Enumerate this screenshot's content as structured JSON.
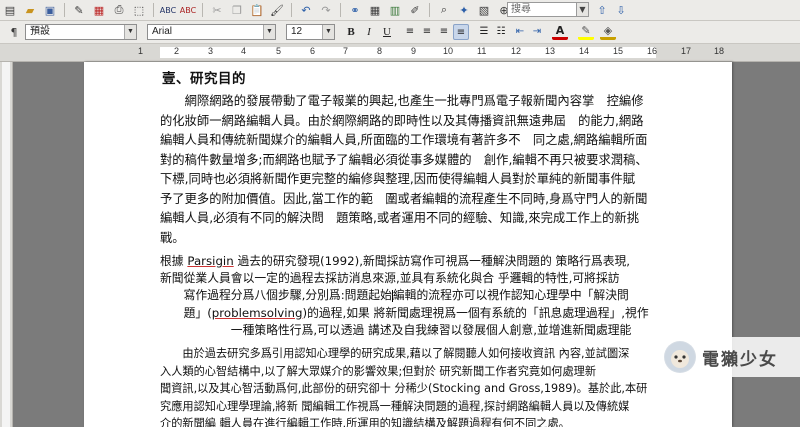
{
  "toolbar": {
    "search_value": "搜尋",
    "icons": [
      "new-icon",
      "open-icon",
      "save-icon",
      "edit-icon",
      "pdf-icon",
      "print-icon",
      "preview-icon",
      "spellcheck-icon",
      "autospell-icon",
      "cut-icon",
      "copy-icon",
      "paste-icon",
      "format-paint-icon",
      "undo-icon",
      "redo-icon",
      "hyperlink-icon",
      "table-icon",
      "chart-icon",
      "draw-icon",
      "find-icon",
      "navigator-icon",
      "gallery-icon",
      "zoom-icon",
      "help-icon"
    ]
  },
  "format": {
    "style": "預設",
    "font": "Arial",
    "size": "12",
    "bold": "B",
    "italic": "I",
    "underline": "U"
  },
  "ruler": {
    "numbers": [
      "1",
      "2",
      "3",
      "4",
      "5",
      "6",
      "7",
      "8",
      "9",
      "10",
      "11",
      "12",
      "13",
      "14",
      "15",
      "16",
      "17",
      "18"
    ]
  },
  "document": {
    "heading": "壹、研究目的",
    "para1": [
      "　　網際網路的發展帶動了電子報業的興起,也產生一批專門爲電子報新聞內容掌　控編修",
      "的化妝師一網路編輯人員。由於網際網路的即時性以及其傳播資訊無遠弗屆　的能力,網路",
      "編輯人員和傳統新聞媒介的編輯人員,所面臨的工作環境有著許多不　同之處,網路編輯所面",
      "對的稿件數量增多;而網路也賦予了編輯必須從事多媒體的　創作,編輯不再只被要求潤稿、",
      "下標,同時也必須將新聞作更完整的編修與整理,因而使得編輯人員對於單純的新聞事件賦",
      "予了更多的附加價值。因此,當工作的範　圍或者編輯的流程產生不同時,身爲守門人的新聞",
      "編輯人員,必須有不同的解決問　題策略,或者運用不同的經驗、知識,來完成工作上的新挑",
      "戰。"
    ],
    "para2_prefix": " 根據 ",
    "para2_name": "Parsigin",
    "para2_rest": " 過去的研究發現(1992),新聞採訪寫作可視爲一種解決問題的 策略行爲表現,",
    "para2": [
      " 新聞從業人員會以一定的過程去採訪消息來源,並具有系統化與合 乎邏輯的特性,可將採訪",
      "　　寫作過程分爲八個步驟,分別爲:問題起始",
      "編輯的流程亦可以視作認知心理學中「解決問",
      "　　題」(",
      "problemsolving",
      ")的過程,如果 將新聞處理視爲一個有系統的「訊息處理過程」,視作",
      "　　　　　　一種策略性行爲,可以透過 講述及自我練習以發展個人創意,並增進新聞處理能"
    ],
    "para3": [
      "　　由於過去研究多爲引用認知心理學的研究成果,藉以了解閱聽人如何接收資訊 內容,並試圖深",
      "入人類的心智結構中,以了解大眾媒介的影響效果;但對於 研究新聞工作者究竟如何處理新",
      "聞資訊,以及其心智活動爲何,此部份的研究卻十 分稀少(Stocking and Gross,1989)。基於此,本研",
      "究應用認知心理學理論,將新 聞編輯工作視爲一種解決問題的過程,探討網路編輯人員以及傳統媒",
      "介的新聞編 輯人員在進行編輯工作時,所運用的知識結構及解題過程有何不同之處。"
    ]
  },
  "watermark": {
    "text": "電獺少女"
  }
}
